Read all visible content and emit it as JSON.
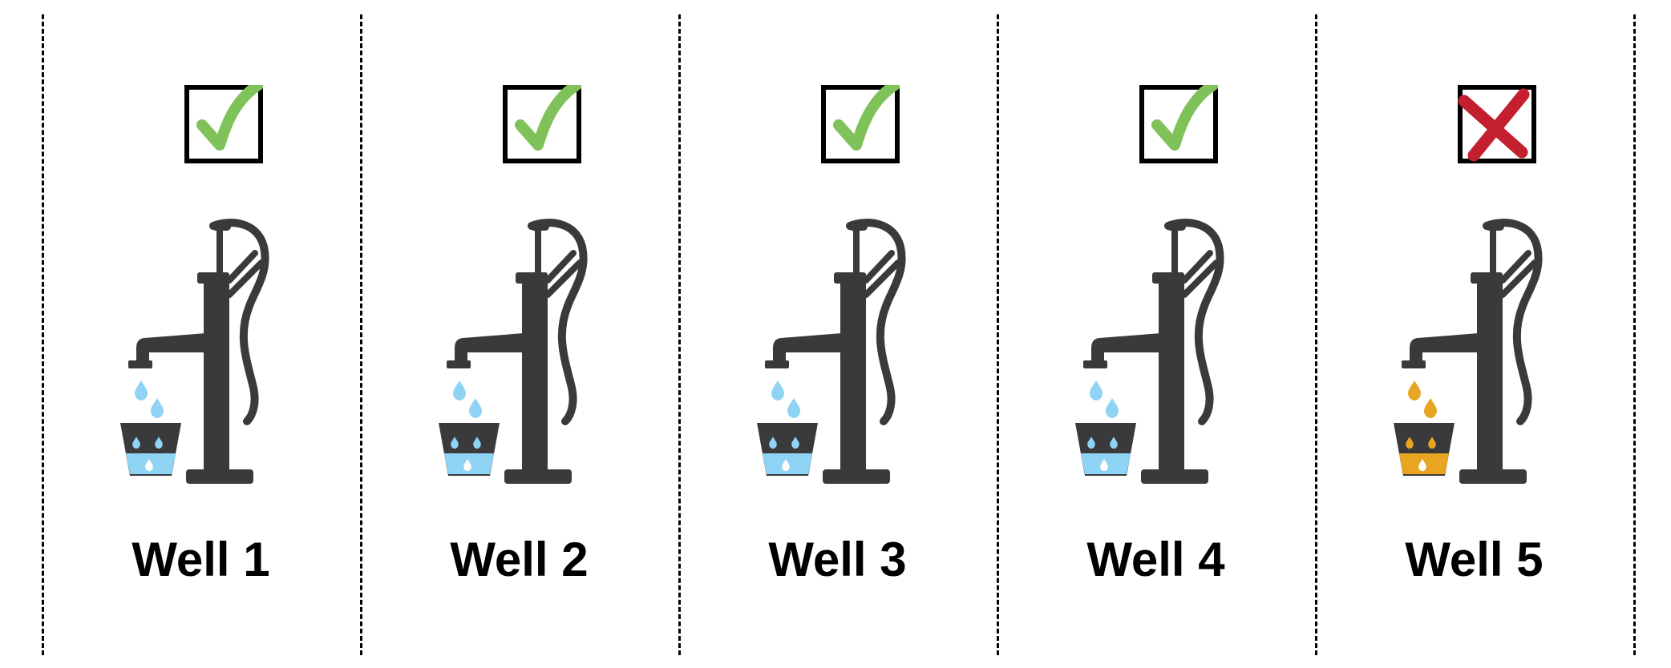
{
  "colors": {
    "pump": "#3a3a3c",
    "clean_water": "#8fd3f5",
    "contaminated_water": "#e8a522",
    "check": "#7fc25a",
    "cross": "#c41f2e"
  },
  "wells": [
    {
      "label": "Well 1",
      "status": "pass",
      "status_icon": "check-mark-icon",
      "water": "clean"
    },
    {
      "label": "Well 2",
      "status": "pass",
      "status_icon": "check-mark-icon",
      "water": "clean"
    },
    {
      "label": "Well 3",
      "status": "pass",
      "status_icon": "check-mark-icon",
      "water": "clean"
    },
    {
      "label": "Well 4",
      "status": "pass",
      "status_icon": "check-mark-icon",
      "water": "clean"
    },
    {
      "label": "Well 5",
      "status": "fail",
      "status_icon": "cross-mark-icon",
      "water": "contaminated"
    }
  ]
}
